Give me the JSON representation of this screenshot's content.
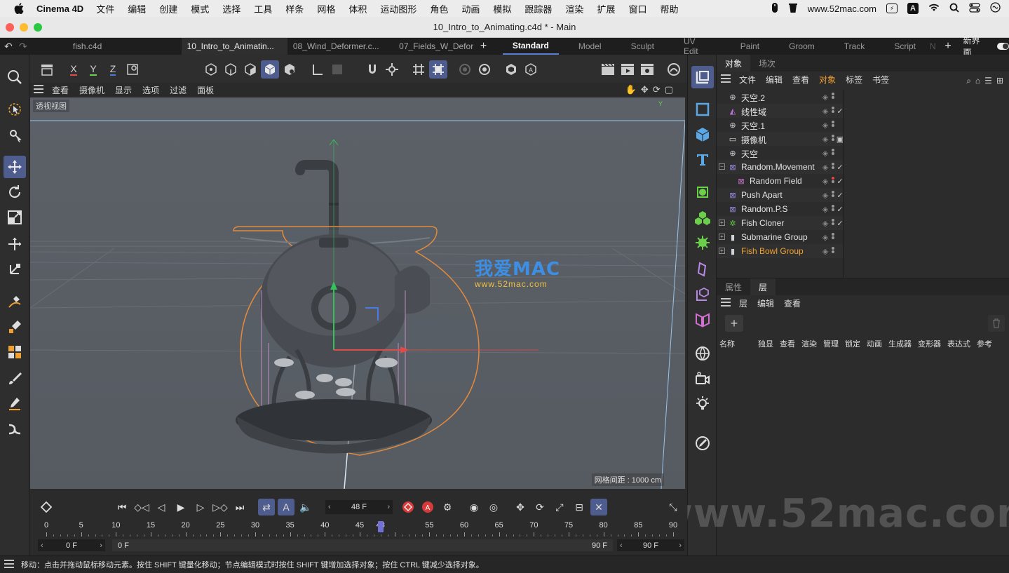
{
  "menubar": {
    "app_name": "Cinema 4D",
    "items": [
      "文件",
      "编辑",
      "创建",
      "模式",
      "选择",
      "工具",
      "样条",
      "网格",
      "体积",
      "运动图形",
      "角色",
      "动画",
      "模拟",
      "跟踪器",
      "渲染",
      "扩展",
      "窗口",
      "帮助"
    ],
    "url": "www.52mac.com"
  },
  "window": {
    "title": "10_Intro_to_Animating.c4d * - Main"
  },
  "doc_tabs": [
    "fish.c4d",
    "10_Intro_to_Animatin...",
    "08_Wind_Deformer.c...",
    "07_Fields_W_Deforn"
  ],
  "layout_tabs": [
    "Standard",
    "Model",
    "Sculpt",
    "UV Edit",
    "Paint",
    "Groom",
    "Track",
    "Script",
    "N"
  ],
  "new_layout_label": "新界面",
  "axis_buttons": [
    "X",
    "Y",
    "Z"
  ],
  "viewport_menu": [
    "查看",
    "摄像机",
    "显示",
    "选项",
    "过滤",
    "面板"
  ],
  "viewport": {
    "label": "透视视图",
    "grid_spacing": "网格间距 : 1000 cm",
    "axis_y": "Y"
  },
  "watermark": {
    "brand": "我爱MAC",
    "url": "www.52mac.com",
    "big": "www.52mac.com"
  },
  "objects_panel": {
    "tabs": [
      "对象",
      "场次"
    ],
    "menu": [
      "文件",
      "编辑",
      "查看",
      "对象",
      "标签",
      "书签"
    ],
    "items": [
      {
        "name": "天空.2",
        "icon": "sky-icon",
        "indent": 0,
        "check": ""
      },
      {
        "name": "线性域",
        "icon": "linear-field-icon",
        "indent": 0,
        "check": "✓"
      },
      {
        "name": "天空.1",
        "icon": "sky-icon",
        "indent": 0,
        "check": ""
      },
      {
        "name": "摄像机",
        "icon": "camera-icon",
        "indent": 0,
        "check": "▣"
      },
      {
        "name": "天空",
        "icon": "sky-icon",
        "indent": 0,
        "check": ""
      },
      {
        "name": "Random.Movement",
        "icon": "random-effector-icon",
        "indent": 0,
        "check": "✓",
        "expander": "−"
      },
      {
        "name": "Random Field",
        "icon": "random-field-icon",
        "indent": 1,
        "check": "✓"
      },
      {
        "name": "Push Apart",
        "icon": "push-apart-icon",
        "indent": 0,
        "check": "✓"
      },
      {
        "name": "Random.P.S",
        "icon": "random-effector-icon",
        "indent": 0,
        "check": "✓"
      },
      {
        "name": "Fish Cloner",
        "icon": "cloner-icon",
        "indent": 0,
        "check": "✓",
        "expander": "+"
      },
      {
        "name": "Submarine Group",
        "icon": "null-icon",
        "indent": 0,
        "check": "",
        "expander": "+"
      },
      {
        "name": "Fish Bowl Group",
        "icon": "null-icon",
        "indent": 0,
        "check": "",
        "expander": "+",
        "highlight": true
      }
    ]
  },
  "layers_panel": {
    "tabs": [
      "属性",
      "层"
    ],
    "menu": [
      "层",
      "编辑",
      "查看"
    ],
    "columns": [
      "名称",
      "独显",
      "查看",
      "渲染",
      "管理",
      "锁定",
      "动画",
      "生成器",
      "变形器",
      "表达式",
      "参考"
    ]
  },
  "timeline": {
    "current_frame": "48 F",
    "ruler": [
      "0",
      "5",
      "10",
      "15",
      "20",
      "25",
      "30",
      "35",
      "40",
      "45",
      "48",
      "55",
      "60",
      "65",
      "70",
      "75",
      "80",
      "85",
      "90"
    ],
    "playhead_frame": 48,
    "start_field": "0 F",
    "range_start": "0 F",
    "range_end": "90 F",
    "end_field": "90 F"
  },
  "status": {
    "text": "移动：点击并拖动鼠标移动元素。按住 SHIFT 键量化移动；节点编辑模式时按住 SHIFT 键增加选择对象；按住 CTRL 键减少选择对象。"
  },
  "colors": {
    "accent": "#4e5d8e",
    "highlight_orange": "#f0a030",
    "viewport_bg": "#5a5f66"
  }
}
